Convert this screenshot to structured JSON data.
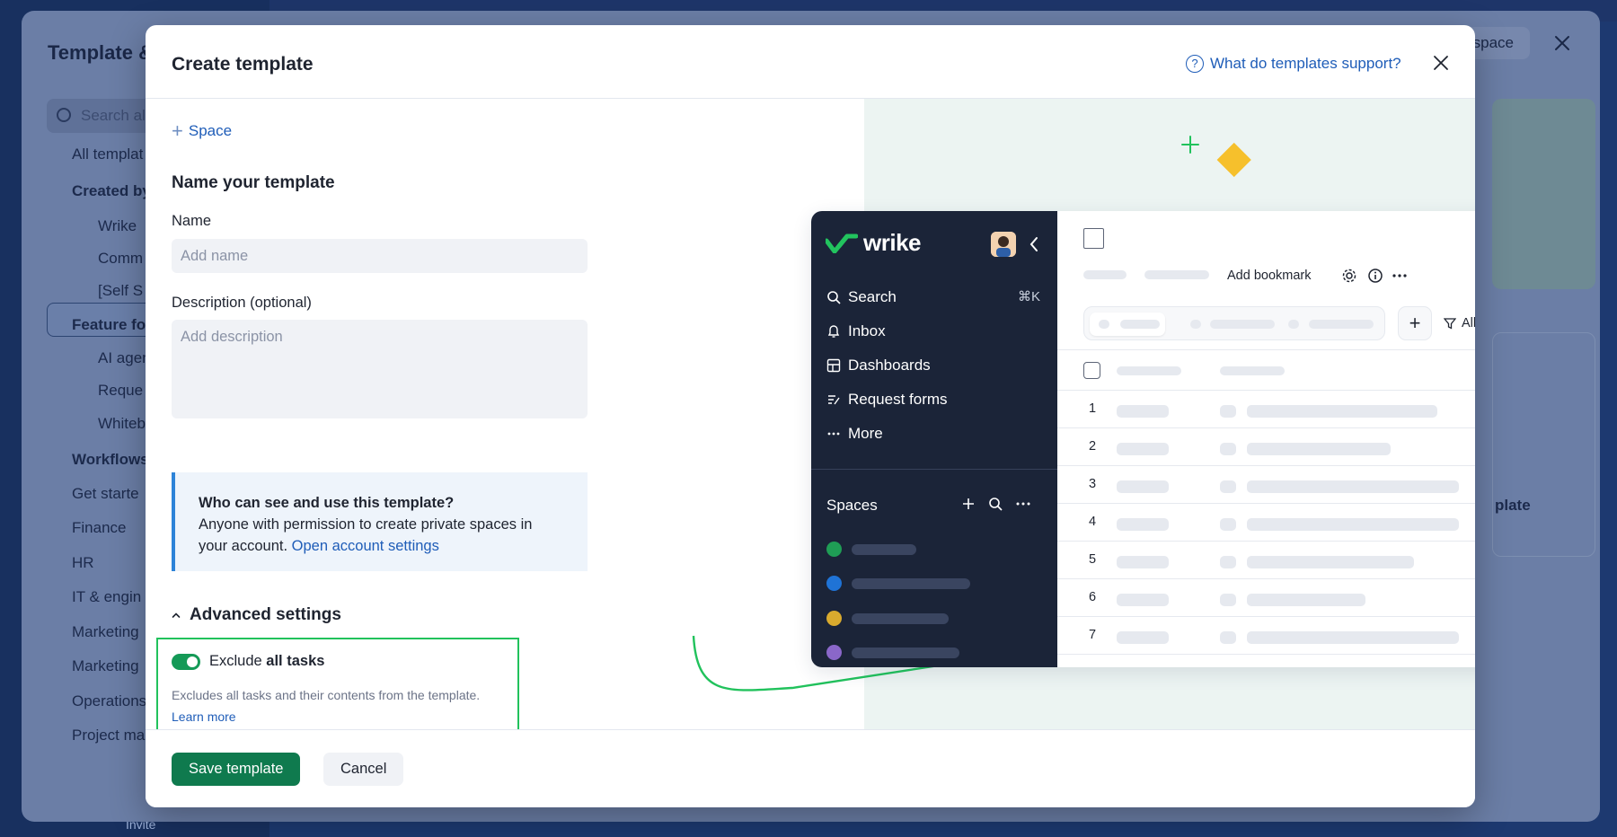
{
  "background": {
    "panel_title": "Template &",
    "space_button": "space",
    "search_placeholder": "Search al",
    "invite": "Invite",
    "right_card_text": "plate",
    "nav": [
      {
        "label": "All templat",
        "heading": false
      },
      {
        "label": "Created by",
        "heading": true
      },
      {
        "label": "Wrike",
        "heading": false
      },
      {
        "label": "Comm",
        "heading": false
      },
      {
        "label": "[Self S",
        "heading": false
      },
      {
        "label": "Feature fo",
        "heading": true
      },
      {
        "label": "AI agen",
        "heading": false
      },
      {
        "label": "Reque",
        "heading": false
      },
      {
        "label": "Whiteb",
        "heading": false
      },
      {
        "label": "Workflows",
        "heading": true
      },
      {
        "label": "Get starte",
        "heading": false
      },
      {
        "label": "Finance",
        "heading": false
      },
      {
        "label": "HR",
        "heading": false
      },
      {
        "label": "IT & engin",
        "heading": false
      },
      {
        "label": "Marketing",
        "heading": false
      },
      {
        "label": "Marketing",
        "heading": false
      },
      {
        "label": "Operations",
        "heading": false
      },
      {
        "label": "Project ma",
        "heading": false
      }
    ]
  },
  "modal": {
    "title": "Create template",
    "help_link": "What do templates support?",
    "space_link": "Space",
    "section_title": "Name your template",
    "name_label": "Name",
    "name_placeholder": "Add name",
    "description_label": "Description (optional)",
    "description_placeholder": "Add description",
    "info": {
      "title": "Who can see and use this template?",
      "body": "Anyone with permission to create private spaces in your account.",
      "link": "Open account settings"
    },
    "advanced_settings": "Advanced settings",
    "exclude": {
      "prefix": "Exclude",
      "bold": "all tasks",
      "enabled": true,
      "description": "Excludes all tasks and their contents from the template.",
      "learn_more": "Learn more"
    },
    "save_button": "Save template",
    "cancel_button": "Cancel"
  },
  "illustration": {
    "logo_text": "wrike",
    "nav": [
      {
        "label": "Search",
        "icon": "search-icon"
      },
      {
        "label": "Inbox",
        "icon": "bell-icon"
      },
      {
        "label": "Dashboards",
        "icon": "dashboard-icon"
      },
      {
        "label": "Request forms",
        "icon": "form-icon"
      },
      {
        "label": "More",
        "icon": "more-icon"
      }
    ],
    "search_shortcut": "⌘K",
    "spaces_label": "Spaces",
    "space_colors": [
      "#1f9d55",
      "#1f73d6",
      "#d9aa2e",
      "#8a67c9"
    ],
    "add_bookmark": "Add bookmark",
    "all_tasks": "All tasks",
    "row_numbers": [
      "1",
      "2",
      "3",
      "4",
      "5",
      "6",
      "7"
    ],
    "accent_green": "#21c25c",
    "accent_yellow": "#f6c02c"
  }
}
